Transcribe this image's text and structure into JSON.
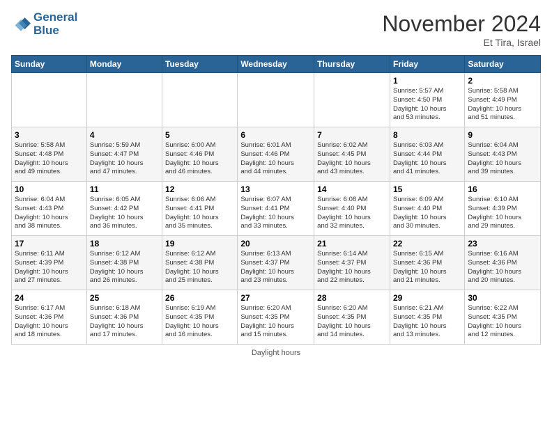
{
  "header": {
    "logo_line1": "General",
    "logo_line2": "Blue",
    "month_title": "November 2024",
    "subtitle": "Et Tira, Israel"
  },
  "days_of_week": [
    "Sunday",
    "Monday",
    "Tuesday",
    "Wednesday",
    "Thursday",
    "Friday",
    "Saturday"
  ],
  "footer": {
    "daylight_label": "Daylight hours"
  },
  "weeks": [
    [
      {
        "day": "",
        "info": ""
      },
      {
        "day": "",
        "info": ""
      },
      {
        "day": "",
        "info": ""
      },
      {
        "day": "",
        "info": ""
      },
      {
        "day": "",
        "info": ""
      },
      {
        "day": "1",
        "info": "Sunrise: 5:57 AM\nSunset: 4:50 PM\nDaylight: 10 hours\nand 53 minutes."
      },
      {
        "day": "2",
        "info": "Sunrise: 5:58 AM\nSunset: 4:49 PM\nDaylight: 10 hours\nand 51 minutes."
      }
    ],
    [
      {
        "day": "3",
        "info": "Sunrise: 5:58 AM\nSunset: 4:48 PM\nDaylight: 10 hours\nand 49 minutes."
      },
      {
        "day": "4",
        "info": "Sunrise: 5:59 AM\nSunset: 4:47 PM\nDaylight: 10 hours\nand 47 minutes."
      },
      {
        "day": "5",
        "info": "Sunrise: 6:00 AM\nSunset: 4:46 PM\nDaylight: 10 hours\nand 46 minutes."
      },
      {
        "day": "6",
        "info": "Sunrise: 6:01 AM\nSunset: 4:46 PM\nDaylight: 10 hours\nand 44 minutes."
      },
      {
        "day": "7",
        "info": "Sunrise: 6:02 AM\nSunset: 4:45 PM\nDaylight: 10 hours\nand 43 minutes."
      },
      {
        "day": "8",
        "info": "Sunrise: 6:03 AM\nSunset: 4:44 PM\nDaylight: 10 hours\nand 41 minutes."
      },
      {
        "day": "9",
        "info": "Sunrise: 6:04 AM\nSunset: 4:43 PM\nDaylight: 10 hours\nand 39 minutes."
      }
    ],
    [
      {
        "day": "10",
        "info": "Sunrise: 6:04 AM\nSunset: 4:43 PM\nDaylight: 10 hours\nand 38 minutes."
      },
      {
        "day": "11",
        "info": "Sunrise: 6:05 AM\nSunset: 4:42 PM\nDaylight: 10 hours\nand 36 minutes."
      },
      {
        "day": "12",
        "info": "Sunrise: 6:06 AM\nSunset: 4:41 PM\nDaylight: 10 hours\nand 35 minutes."
      },
      {
        "day": "13",
        "info": "Sunrise: 6:07 AM\nSunset: 4:41 PM\nDaylight: 10 hours\nand 33 minutes."
      },
      {
        "day": "14",
        "info": "Sunrise: 6:08 AM\nSunset: 4:40 PM\nDaylight: 10 hours\nand 32 minutes."
      },
      {
        "day": "15",
        "info": "Sunrise: 6:09 AM\nSunset: 4:40 PM\nDaylight: 10 hours\nand 30 minutes."
      },
      {
        "day": "16",
        "info": "Sunrise: 6:10 AM\nSunset: 4:39 PM\nDaylight: 10 hours\nand 29 minutes."
      }
    ],
    [
      {
        "day": "17",
        "info": "Sunrise: 6:11 AM\nSunset: 4:39 PM\nDaylight: 10 hours\nand 27 minutes."
      },
      {
        "day": "18",
        "info": "Sunrise: 6:12 AM\nSunset: 4:38 PM\nDaylight: 10 hours\nand 26 minutes."
      },
      {
        "day": "19",
        "info": "Sunrise: 6:12 AM\nSunset: 4:38 PM\nDaylight: 10 hours\nand 25 minutes."
      },
      {
        "day": "20",
        "info": "Sunrise: 6:13 AM\nSunset: 4:37 PM\nDaylight: 10 hours\nand 23 minutes."
      },
      {
        "day": "21",
        "info": "Sunrise: 6:14 AM\nSunset: 4:37 PM\nDaylight: 10 hours\nand 22 minutes."
      },
      {
        "day": "22",
        "info": "Sunrise: 6:15 AM\nSunset: 4:36 PM\nDaylight: 10 hours\nand 21 minutes."
      },
      {
        "day": "23",
        "info": "Sunrise: 6:16 AM\nSunset: 4:36 PM\nDaylight: 10 hours\nand 20 minutes."
      }
    ],
    [
      {
        "day": "24",
        "info": "Sunrise: 6:17 AM\nSunset: 4:36 PM\nDaylight: 10 hours\nand 18 minutes."
      },
      {
        "day": "25",
        "info": "Sunrise: 6:18 AM\nSunset: 4:36 PM\nDaylight: 10 hours\nand 17 minutes."
      },
      {
        "day": "26",
        "info": "Sunrise: 6:19 AM\nSunset: 4:35 PM\nDaylight: 10 hours\nand 16 minutes."
      },
      {
        "day": "27",
        "info": "Sunrise: 6:20 AM\nSunset: 4:35 PM\nDaylight: 10 hours\nand 15 minutes."
      },
      {
        "day": "28",
        "info": "Sunrise: 6:20 AM\nSunset: 4:35 PM\nDaylight: 10 hours\nand 14 minutes."
      },
      {
        "day": "29",
        "info": "Sunrise: 6:21 AM\nSunset: 4:35 PM\nDaylight: 10 hours\nand 13 minutes."
      },
      {
        "day": "30",
        "info": "Sunrise: 6:22 AM\nSunset: 4:35 PM\nDaylight: 10 hours\nand 12 minutes."
      }
    ]
  ]
}
